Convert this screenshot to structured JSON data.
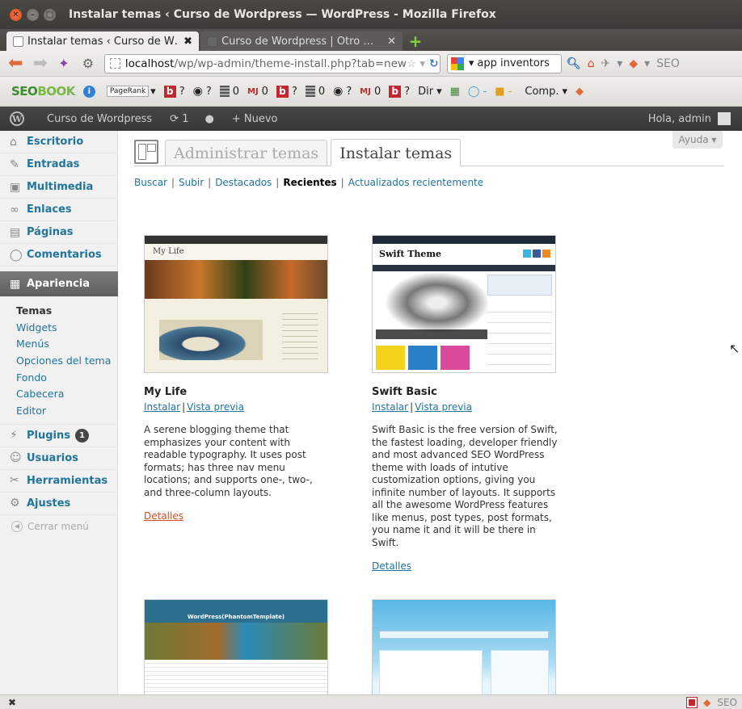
{
  "window": {
    "title": "Instalar temas ‹ Curso de Wordpress — WordPress - Mozilla Firefox"
  },
  "tabs": [
    {
      "label": "Instalar temas ‹ Curso de W…"
    },
    {
      "label": "Curso de Wordpress | Otro …"
    }
  ],
  "navbar": {
    "url_host": "localhost",
    "url_path": "/wp/wp-admin/theme-install.php?tab=new",
    "search_value": "app inventors",
    "seo_label": "SEO"
  },
  "seobar": {
    "logo_seo": "SEO",
    "logo_book": "BOOK",
    "pagerank_label": "PageRank",
    "items": [
      "?",
      "?",
      "0",
      "0",
      "?",
      "0",
      "?",
      "0",
      "?"
    ],
    "dir_label": "Dir",
    "comp_label": "Comp."
  },
  "wpbar": {
    "site_name": "Curso de Wordpress",
    "updates_count": "1",
    "new_label": "+ Nuevo",
    "greeting": "Hola, admin"
  },
  "sidebar": {
    "items": [
      {
        "label": "Escritorio",
        "icon": "home-icon"
      },
      {
        "label": "Entradas",
        "icon": "pin-icon"
      },
      {
        "label": "Multimedia",
        "icon": "media-icon"
      },
      {
        "label": "Enlaces",
        "icon": "link-icon"
      },
      {
        "label": "Páginas",
        "icon": "pages-icon"
      },
      {
        "label": "Comentarios",
        "icon": "comments-icon"
      }
    ],
    "current": {
      "label": "Apariencia",
      "icon": "appearance-icon"
    },
    "submenu": [
      "Temas",
      "Widgets",
      "Menús",
      "Opciones del tema",
      "Fondo",
      "Cabecera",
      "Editor"
    ],
    "lower_items": [
      {
        "label": "Plugins",
        "icon": "plugins-icon",
        "badge": "1"
      },
      {
        "label": "Usuarios",
        "icon": "users-icon"
      },
      {
        "label": "Herramientas",
        "icon": "tools-icon"
      },
      {
        "label": "Ajustes",
        "icon": "settings-icon"
      }
    ],
    "collapse_label": "Cerrar menú"
  },
  "main": {
    "help_label": "Ayuda ▾",
    "tabs": [
      {
        "label": "Administrar temas",
        "active": false
      },
      {
        "label": "Instalar temas",
        "active": true
      }
    ],
    "subsubsub": [
      {
        "label": "Buscar"
      },
      {
        "label": "Subir"
      },
      {
        "label": "Destacados"
      },
      {
        "label": "Recientes",
        "current": true
      },
      {
        "label": "Actualizados recientemente"
      }
    ],
    "themes": [
      {
        "name": "My Life",
        "install_label": "Instalar",
        "preview_label": "Vista previa",
        "description": "A serene blogging theme that emphasizes your content with readable typography. It uses post formats; has three nav menu locations; and supports one-, two-, and three-column layouts.",
        "details_label": "Detalles",
        "shot_title": "My Life"
      },
      {
        "name": "Swift Basic",
        "install_label": "Instalar",
        "preview_label": "Vista previa",
        "description": "Swift Basic is the free version of Swift, the fastest loading, developer friendly and most advanced SEO WordPress theme with loads of intutive customization options, giving you infinite number of layouts. It supports all the awesome WordPress features like menus, post types, post formats, you name it and it will be there in Swift.",
        "details_label": "Detalles",
        "shot_title": "Swift Theme"
      },
      {
        "shot_title": "WordPress(PhantomTemplate)"
      }
    ]
  },
  "statusbar": {
    "close_glyph": "✖",
    "seo_label": "SEO"
  }
}
